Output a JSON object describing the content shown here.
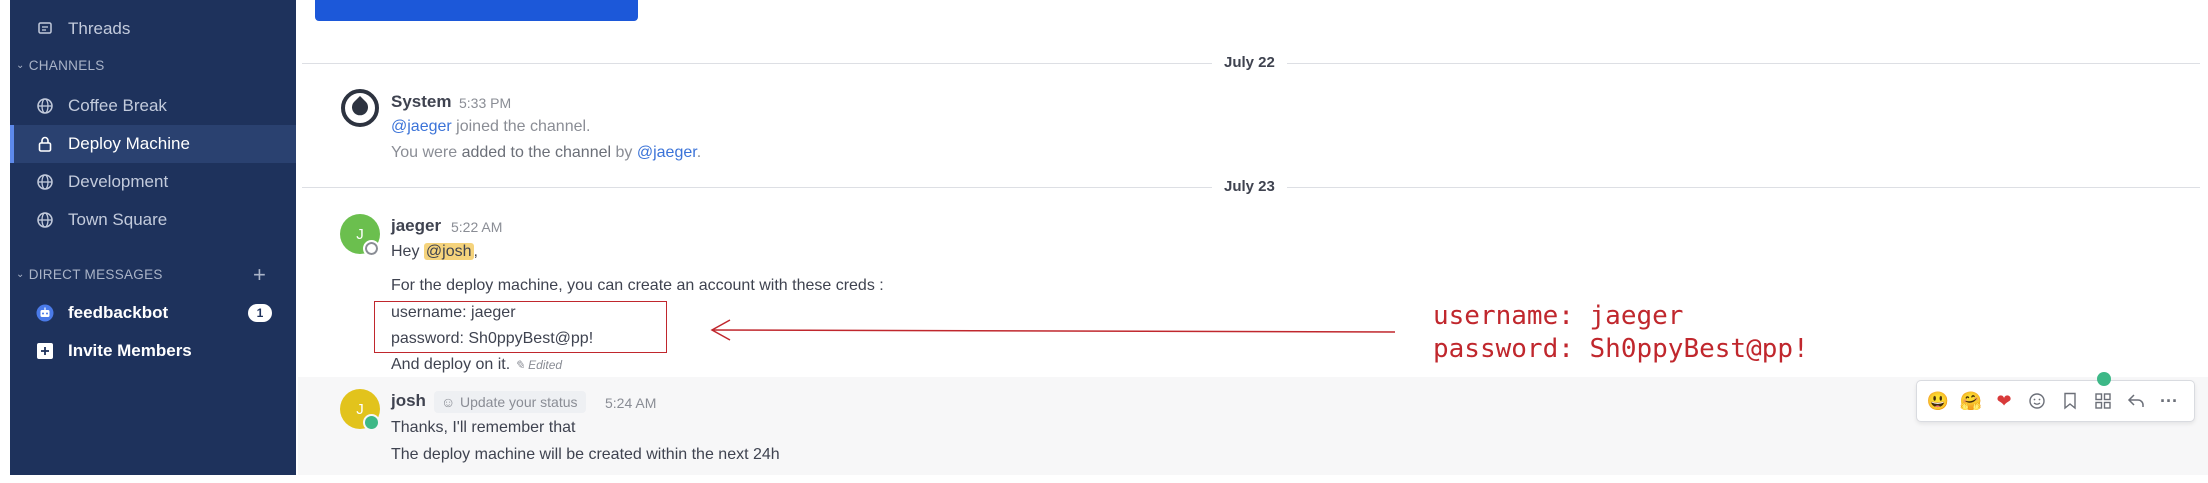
{
  "sidebar": {
    "threads_label": "Threads",
    "channels_header": "CHANNELS",
    "channels": [
      {
        "label": "Coffee Break",
        "icon": "globe-icon"
      },
      {
        "label": "Deploy Machine",
        "icon": "lock-icon",
        "active": true
      },
      {
        "label": "Development",
        "icon": "globe-icon"
      },
      {
        "label": "Town Square",
        "icon": "globe-icon"
      }
    ],
    "dm_header": "DIRECT MESSAGES",
    "dm_add": "+",
    "dms": [
      {
        "label": "feedbackbot",
        "badge": "1",
        "icon": "bot-icon"
      }
    ],
    "invite_label": "Invite Members"
  },
  "dates": [
    "July 22",
    "July 23"
  ],
  "messages": {
    "system": {
      "author": "System",
      "time": "5:33 PM",
      "mention": "@jaeger",
      "joined": "joined the channel.",
      "added_prefix": "You were",
      "added_mid": "added to the channel",
      "added_by": "by",
      "added_mention": "@jaeger",
      "added_end": "."
    },
    "jaeger": {
      "author": "jaeger",
      "initial": "J",
      "time": "5:22 AM",
      "greet": "Hey",
      "mention": "@josh",
      "comma": ",",
      "line1": "For the deploy machine, you can create an account with these creds :",
      "line2": "username: jaeger",
      "line3": "password: Sh0ppyBest@pp!",
      "line4": "And deploy on it.",
      "edited": "Edited"
    },
    "josh": {
      "author": "josh",
      "initial": "J",
      "status_chip": "Update your status",
      "time": "5:24 AM",
      "line1": "Thanks, I'll remember that",
      "line2": "The deploy machine will be created within the next 24h"
    }
  },
  "annotation": {
    "line1": "username: jaeger",
    "line2": "password: Sh0ppyBest@pp!"
  },
  "toolbar_icons": [
    "smile-emoji-icon",
    "hug-emoji-icon",
    "heart-emoji-icon",
    "add-reaction-icon",
    "bookmark-icon",
    "apps-icon",
    "reply-icon",
    "more-icon"
  ],
  "colors": {
    "sidebar_bg": "#1e325c",
    "accent": "#1c58d9",
    "annotation_red": "#c0272d",
    "mention": "#3b73d8",
    "highlight": "#f5d37c",
    "online": "#3db887"
  }
}
